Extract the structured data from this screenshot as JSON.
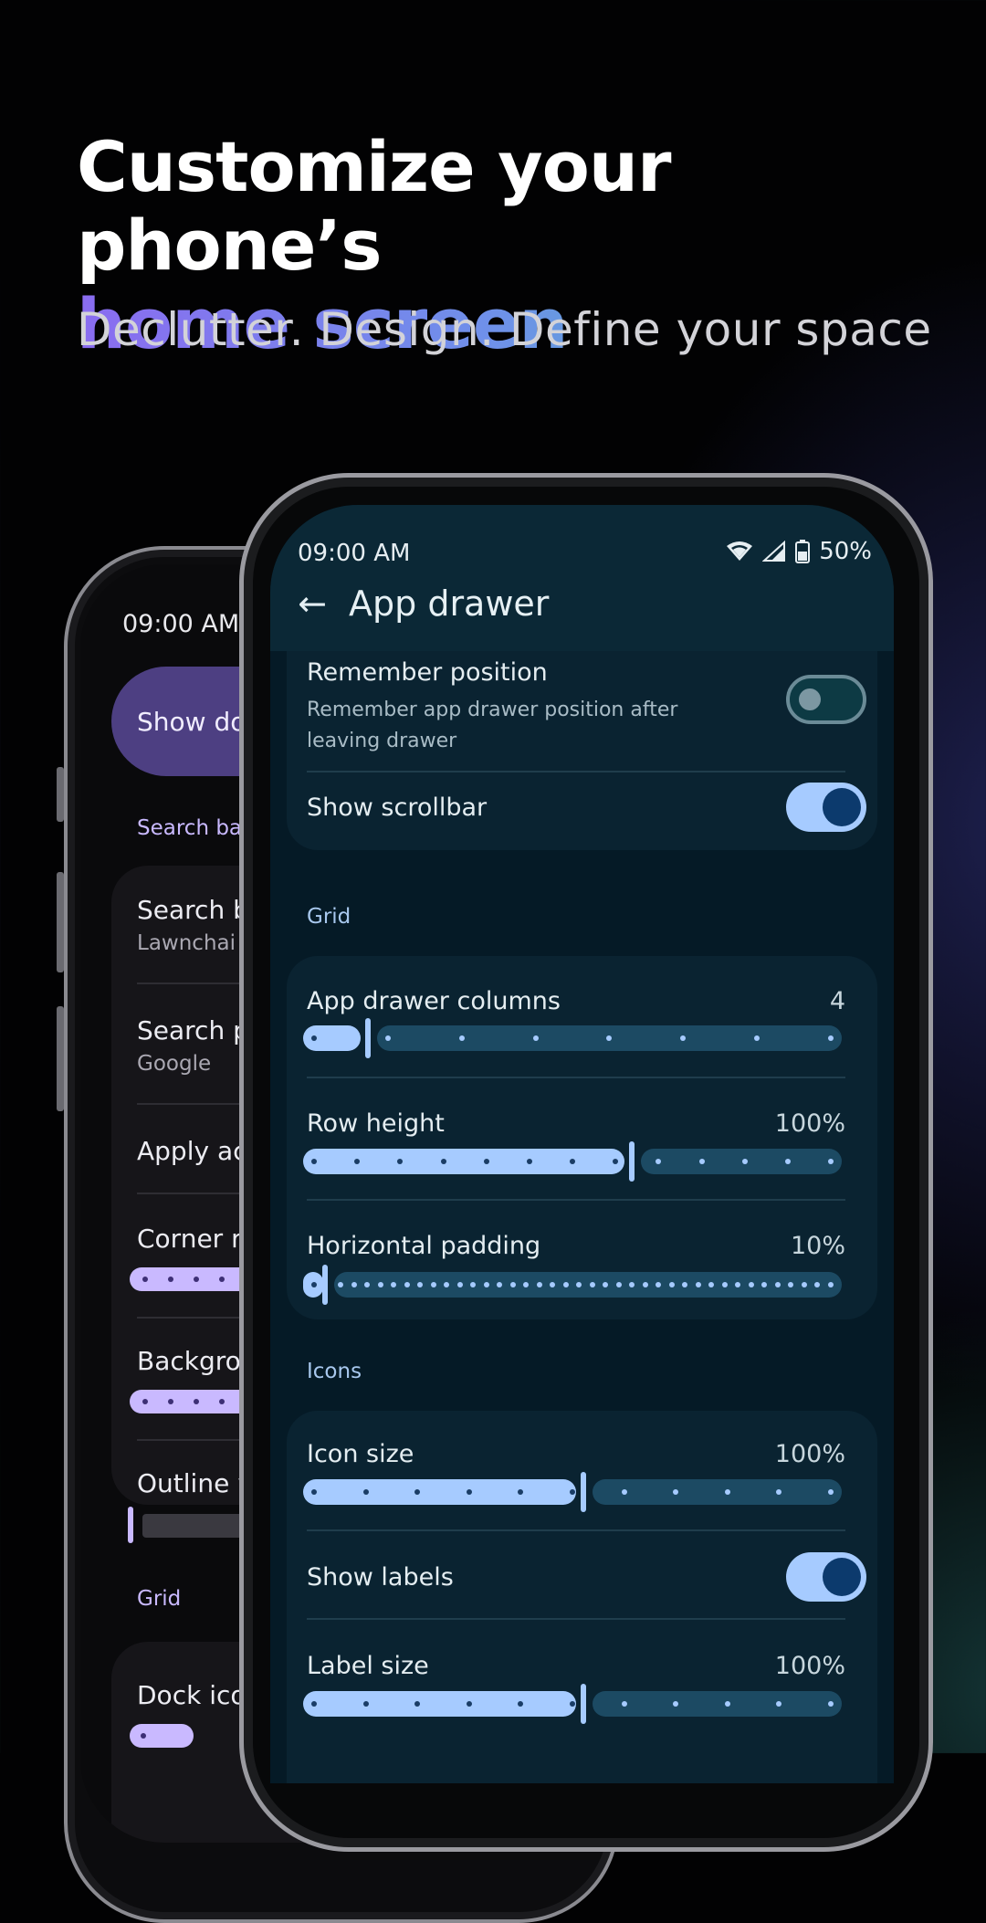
{
  "headline": {
    "line1": "Customize your phone’s",
    "line2": "home screen",
    "subtitle": "Declutter. Design. Define your space"
  },
  "back_phone": {
    "time": "09:00 AM",
    "top_card": "Show do",
    "section_search": "Search ba",
    "items": [
      {
        "title": "Search b",
        "sub": "Lawnchai"
      },
      {
        "title": "Search p",
        "sub": "Google"
      },
      {
        "title": "Apply ac"
      },
      {
        "title": "Corner ra"
      },
      {
        "title": "Backgrou"
      },
      {
        "title": "Outline w"
      }
    ],
    "section_grid": "Grid",
    "grid_item": "Dock ico"
  },
  "front_phone": {
    "status": {
      "time": "09:00 AM",
      "battery": "50%",
      "icons": [
        "wifi-icon",
        "cell-signal-icon",
        "battery-icon"
      ]
    },
    "title": "App drawer",
    "general": {
      "remember_position": {
        "title": "Remember position",
        "subtitle": "Remember app drawer position after leaving drawer",
        "enabled": false
      },
      "show_scrollbar": {
        "title": "Show scrollbar",
        "enabled": true
      }
    },
    "grid_section": "Grid",
    "grid": {
      "columns": {
        "title": "App drawer columns",
        "value": "4"
      },
      "row_height": {
        "title": "Row height",
        "value": "100%"
      },
      "horizontal_padding": {
        "title": "Horizontal padding",
        "value": "10%"
      }
    },
    "icons_section": "Icons",
    "icons": {
      "icon_size": {
        "title": "Icon size",
        "value": "100%"
      },
      "show_labels": {
        "title": "Show labels",
        "enabled": true
      },
      "label_size": {
        "title": "Label size",
        "value": "100%"
      }
    }
  },
  "colors": {
    "accent": "#a6cbff",
    "card": "#0a2331",
    "screen": "#051a26",
    "back_accent": "#c9b9ff"
  }
}
